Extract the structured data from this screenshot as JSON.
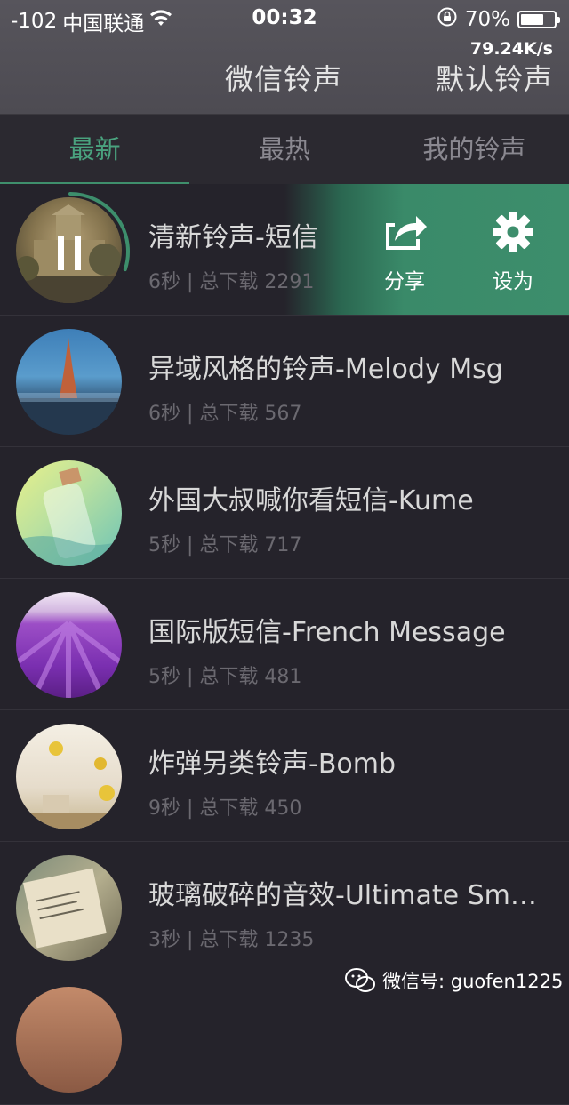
{
  "status": {
    "signal": "-102",
    "carrier": "中国联通",
    "time": "00:32",
    "battery": "70%",
    "battery_level": 0.7,
    "speed": "79.24K/s"
  },
  "nav": {
    "title": "微信铃声",
    "right": "默认铃声"
  },
  "tabs": [
    "最新",
    "最热",
    "我的铃声"
  ],
  "actions": {
    "share": "分享",
    "set": "设为"
  },
  "playback_progress": 0.3,
  "items": [
    {
      "title": "清新铃声-短信",
      "meta": "6秒 | 总下载 2291"
    },
    {
      "title": "异域风格的铃声-Melody Msg",
      "meta": "6秒 | 总下载 567"
    },
    {
      "title": "外国大叔喊你看短信-Kume",
      "meta": "5秒 | 总下载 717"
    },
    {
      "title": "国际版短信-French Message",
      "meta": "5秒 | 总下载 481"
    },
    {
      "title": "炸弹另类铃声-Bomb",
      "meta": "9秒 | 总下载 450"
    },
    {
      "title": "玻璃破碎的音效-Ultimate Sm…",
      "meta": "3秒 | 总下载 1235"
    }
  ],
  "watermark": "微信号: guofen1225"
}
